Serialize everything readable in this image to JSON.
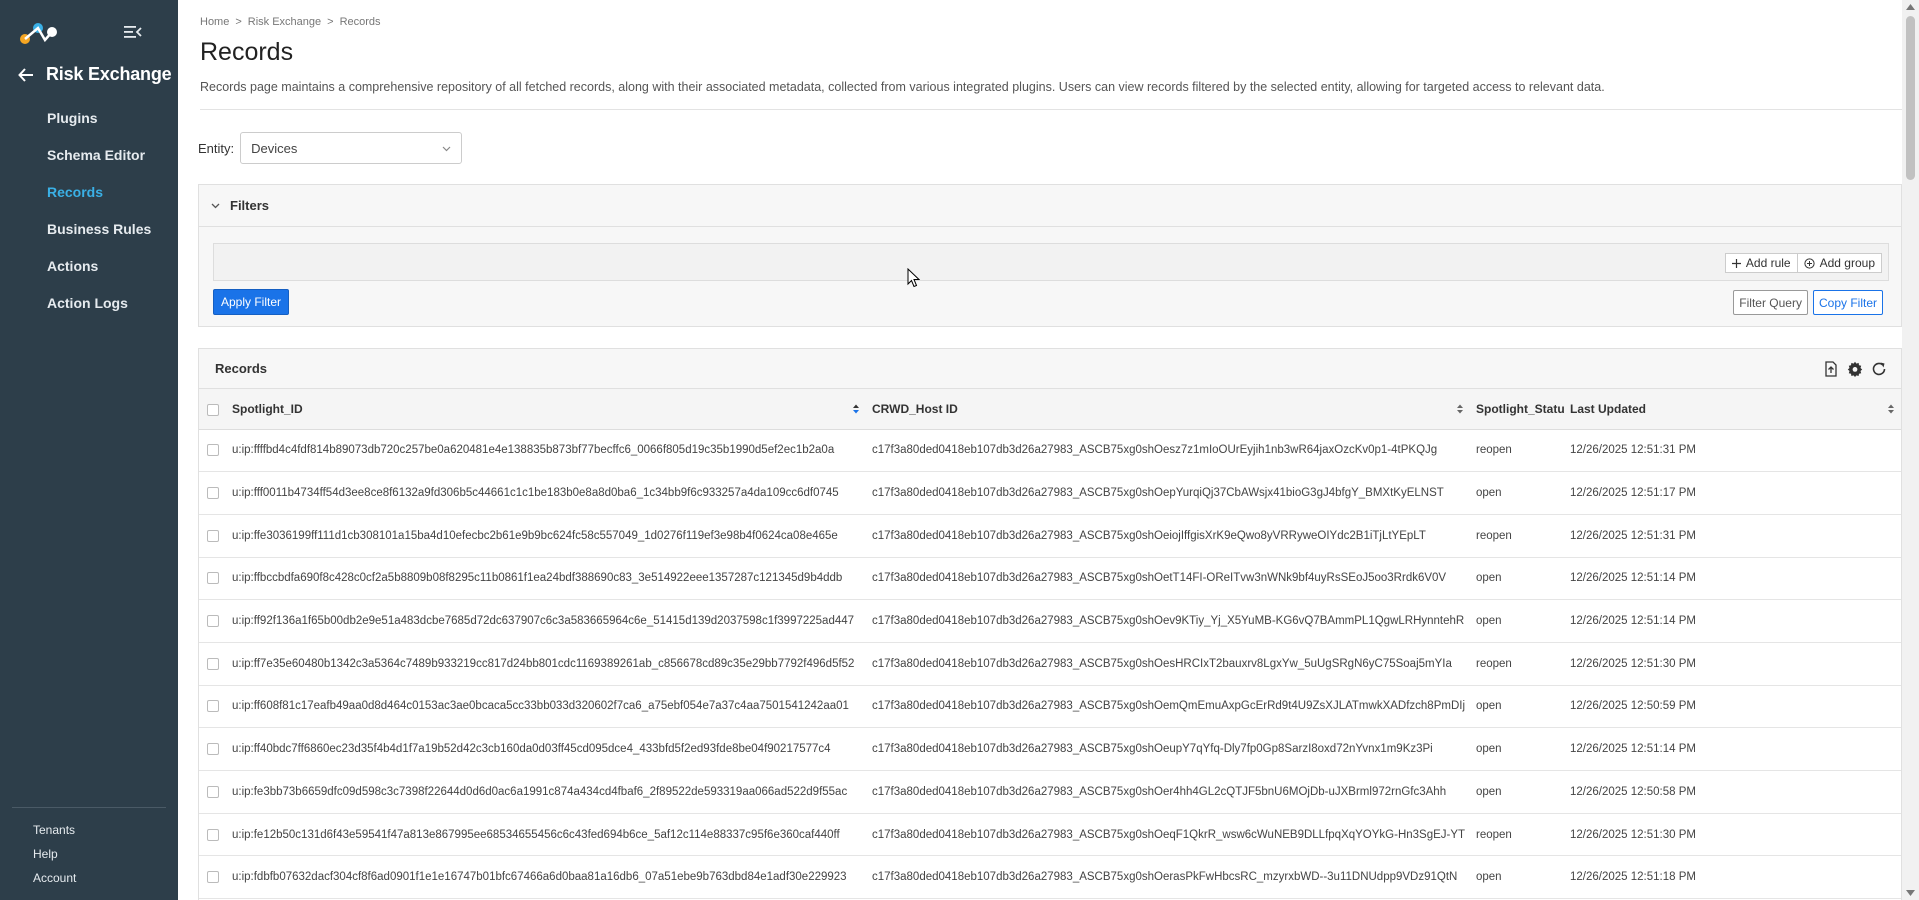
{
  "sidebar": {
    "app_title": "Risk Exchange",
    "items": [
      {
        "label": "Plugins",
        "active": false
      },
      {
        "label": "Schema Editor",
        "active": false
      },
      {
        "label": "Records",
        "active": true
      },
      {
        "label": "Business Rules",
        "active": false
      },
      {
        "label": "Actions",
        "active": false
      },
      {
        "label": "Action Logs",
        "active": false
      }
    ],
    "bottom_items": [
      {
        "label": "Tenants"
      },
      {
        "label": "Help"
      },
      {
        "label": "Account"
      }
    ]
  },
  "breadcrumb": [
    "Home",
    "Risk Exchange",
    "Records"
  ],
  "breadcrumb_separator": ">",
  "page": {
    "title": "Records",
    "description": "Records page maintains a comprehensive repository of all fetched records, along with their associated metadata, collected from various integrated plugins. Users can view records filtered by the selected entity, allowing for targeted access to relevant data."
  },
  "entity": {
    "label": "Entity:",
    "selected": "Devices"
  },
  "filters": {
    "title": "Filters",
    "add_rule": "Add rule",
    "add_group": "Add group",
    "apply": "Apply Filter",
    "filter_query": "Filter Query",
    "copy_filter": "Copy Filter"
  },
  "records": {
    "title": "Records",
    "columns": [
      "Spotlight_ID",
      "CRWD_Host ID",
      "Spotlight_Status",
      "Last Updated"
    ],
    "rows": [
      [
        "u:ip:ffffbd4c4fdf814b89073db720c257be0a620481e4e138835b873bf77becffc6_0066f805d19c35b1990d5ef2ec1b2a0a",
        "c17f3a80ded0418eb107db3d26a27983_ASCB75xg0shOesz7z1mIoOUrEyjih1nb3wR64jaxOzcKv0p1-4tPKQJg",
        "reopen",
        "12/26/2025 12:51:31 PM"
      ],
      [
        "u:ip:fff0011b4734ff54d3ee8ce8f6132a9fd306b5c44661c1c1be183b0e8a8d0ba6_1c34bb9f6c933257a4da109cc6df0745",
        "c17f3a80ded0418eb107db3d26a27983_ASCB75xg0shOepYurqiQj37CbAWsjx41bioG3gJ4bfgY_BMXtKyELNST",
        "open",
        "12/26/2025 12:51:17 PM"
      ],
      [
        "u:ip:ffe3036199ff111d1cb308101a15ba4d10efecbc2b61e9b9bc624fc58c557049_1d0276f119ef3e98b4f0624ca08e465e",
        "c17f3a80ded0418eb107db3d26a27983_ASCB75xg0shOeiojIffgisXrK9eQwo8yVRRyweOIYdc2B1iTjLtYEpLT",
        "reopen",
        "12/26/2025 12:51:31 PM"
      ],
      [
        "u:ip:ffbccbdfa690f8c428c0cf2a5b8809b08f8295c11b0861f1ea24bdf388690c83_3e514922eee1357287c121345d9b4ddb",
        "c17f3a80ded0418eb107db3d26a27983_ASCB75xg0shOetT14FI-OReITvw3nWNk9bf4uyRsSEoJ5oo3Rrdk6V0V",
        "open",
        "12/26/2025 12:51:14 PM"
      ],
      [
        "u:ip:ff92f136a1f65b00db2e9e51a483dcbe7685d72dc637907c6c3a583665964c6e_51415d139d2037598c1f3997225ad447",
        "c17f3a80ded0418eb107db3d26a27983_ASCB75xg0shOev9KTiy_Yj_X5YuMB-KG6vQ7BAmmPL1QgwLRHynntehR",
        "open",
        "12/26/2025 12:51:14 PM"
      ],
      [
        "u:ip:ff7e35e60480b1342c3a5364c7489b933219cc817d24bb801cdc1169389261ab_c856678cd89c35e29bb7792f496d5f52",
        "c17f3a80ded0418eb107db3d26a27983_ASCB75xg0shOesHRCIxT2bauxrv8LgxYw_5uUgSRgN6yC75Soaj5mYIa",
        "reopen",
        "12/26/2025 12:51:30 PM"
      ],
      [
        "u:ip:ff608f81c17eafb49aa0d8d464c0153ac3ae0bcaca5cc33bb033d320602f7ca6_a75ebf054e7a37c4aa7501541242aa01",
        "c17f3a80ded0418eb107db3d26a27983_ASCB75xg0shOemQmEmuAxpGcErRd9t4U9ZsXJLATmwkXADfzch8PmDIj",
        "open",
        "12/26/2025 12:50:59 PM"
      ],
      [
        "u:ip:ff40bdc7ff6860ec23d35f4b4d1f7a19b52d42c3cb160da0d03ff45cd095dce4_433bfd5f2ed93fde8be04f90217577c4",
        "c17f3a80ded0418eb107db3d26a27983_ASCB75xg0shOeupY7qYfq-Dly7fp0Gp8SarzI8oxd72nYvnx1m9Kz3Pi",
        "open",
        "12/26/2025 12:51:14 PM"
      ],
      [
        "u:ip:fe3bb73b6659dfc09d598c3c7398f22644d0d6d0ac6a1991c874a434cd4fbaf6_2f89522de593319aa066ad522d9f55ac",
        "c17f3a80ded0418eb107db3d26a27983_ASCB75xg0shOer4hh4GL2cQTJF5bnU6MOjDb-uJXBrml972rnGfc3Ahh",
        "open",
        "12/26/2025 12:50:58 PM"
      ],
      [
        "u:ip:fe12b50c131d6f43e59541f47a813e867995ee68534655456c6c43fed694b6ce_5af12c114e88337c95f6e360caf440ff",
        "c17f3a80ded0418eb107db3d26a27983_ASCB75xg0shOeqF1QkrR_wsw6cWuNEB9DLLfpqXqYOYkG-Hn3SgEJ-YT",
        "reopen",
        "12/26/2025 12:51:30 PM"
      ],
      [
        "u:ip:fdbfb07632dacf304cf8f6ad0901f1e1e16747b01bfc67466a6d0baa81a16db6_07a51ebe9b763dbd84e1adf30e229923",
        "c17f3a80ded0418eb107db3d26a27983_ASCB75xg0shOerasPkFwHbcsRC_mzyrxbWD--3u11DNUdpp9VDz91QtN",
        "open",
        "12/26/2025 12:51:18 PM"
      ]
    ]
  },
  "colors": {
    "sidebar_bg": "#2d3e4a",
    "active_nav": "#3ab0e6",
    "primary": "#1a73e8"
  },
  "icons": {
    "logo": "netskope-logo",
    "collapse": "menu-collapse-icon",
    "back": "arrow-left-icon",
    "export": "export-file-icon",
    "settings": "gear-icon",
    "refresh": "refresh-icon"
  }
}
